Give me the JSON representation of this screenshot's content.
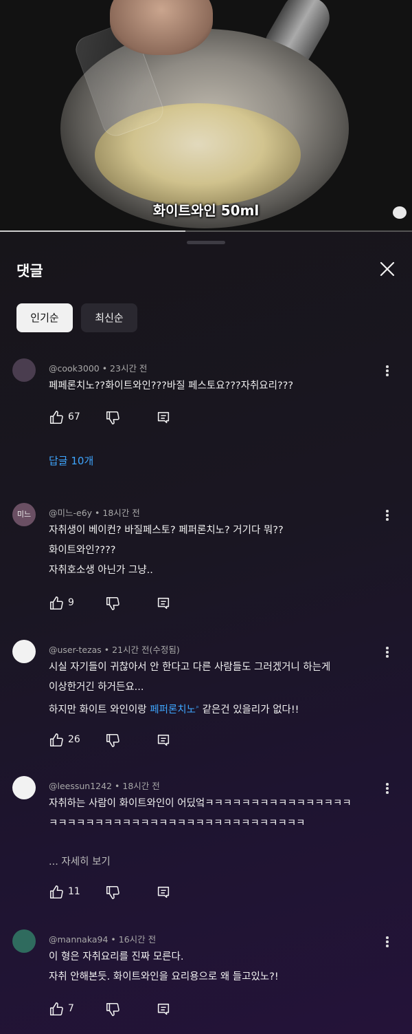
{
  "video": {
    "caption": "화이트와인 50ml",
    "progress_fraction": 0.45
  },
  "comments_panel": {
    "title": "댓글",
    "sort_chips": [
      "인기순",
      "최신순"
    ],
    "comments": [
      {
        "author": "@cook3000",
        "time": "23시간 전",
        "lines": [
          "페페론치노??화이트와인???바질 페스토요???자취요리???"
        ],
        "likes": "67",
        "replies_label": "답글 10개",
        "avatar_color": "#4a3d4f"
      },
      {
        "author": "@미느-e6y",
        "time": "18시간 전",
        "lines": [
          "자취생이 베이컨? 바질페스토? 페퍼론치노? 거기다 뭐??",
          "화이트와인????",
          "자취호소생 아닌가 그냥.."
        ],
        "likes": "9",
        "avatar_text": "미느",
        "avatar_color": "#6a4f63"
      },
      {
        "author": "@user-tezas",
        "time": "21시간 전(수정됨)",
        "lines_pre": [
          "시실 자기들이 귀찮아서 안 한다고 다른 사람들도 그러겠거니 하는게",
          "이상한거긴 하거든요..."
        ],
        "line3_before": "하지만 화이트 와인이랑 ",
        "line3_link": "페퍼론치노",
        "line3_after": " 같은건 있을리가 없다!!",
        "likes": "26",
        "avatar_color": "#f2f2f2"
      },
      {
        "author": "@leessun1242",
        "time": "18시간 전",
        "lines": [
          "자취하는 사람이 화이트와인이 어딨엌ㅋㅋㅋㅋㅋㅋㅋㅋㅋㅋㅋㅋㅋㅋㅋㅋ",
          "ㅋㅋㅋㅋㅋㅋㅋㅋㅋㅋㅋㅋㅋㅋㅋㅋㅋㅋㅋㅋㅋㅋㅋㅋㅋㅋㅋㅋ"
        ],
        "read_more": "... 자세히 보기",
        "likes": "11",
        "avatar_color": "#f2f2f2"
      },
      {
        "author": "@mannaka94",
        "time": "16시간 전",
        "lines": [
          "이 형은 자취요리를 진짜 모른다.",
          "자취 안해본듯. 화이트와인을 요리용으로 왜 들고있노?!"
        ],
        "likes": "7",
        "avatar_color": "#2f6b5e"
      }
    ]
  },
  "icons": [
    "close-icon",
    "thumbs-up-icon",
    "thumbs-down-icon",
    "reply-icon",
    "more-vert-icon",
    "search-link-icon"
  ]
}
